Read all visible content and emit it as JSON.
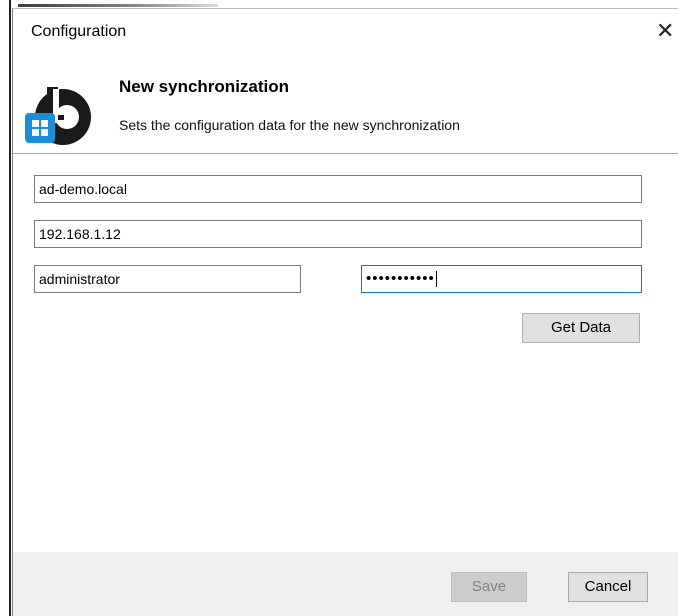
{
  "window": {
    "title": "Configuration",
    "close_glyph": "✕"
  },
  "header": {
    "title": "New synchronization",
    "subtitle": "Sets the configuration data for the new synchronization",
    "logo_icon": "b-logo-with-windows-badge-icon",
    "logo_color": "#1a1a1a",
    "badge_color": "#1a8fd8"
  },
  "form": {
    "domain_value": "ad-demo.local",
    "server_value": "192.168.1.12",
    "username_value": "administrator",
    "password_value": "•••••••••••",
    "get_data_label": "Get Data"
  },
  "footer": {
    "save_label": "Save",
    "cancel_label": "Cancel"
  },
  "colors": {
    "focus_border": "#0078d7",
    "footer_bg": "#f0f0f0",
    "button_bg": "#e1e1e1"
  }
}
